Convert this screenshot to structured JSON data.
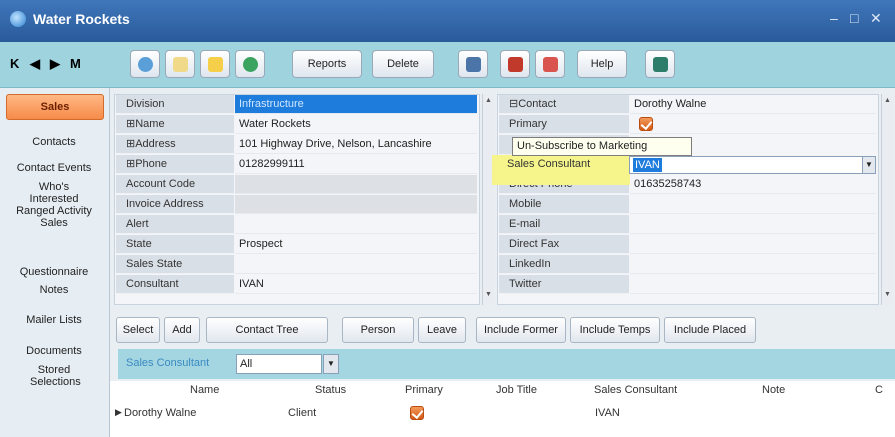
{
  "window": {
    "title": "Water Rockets"
  },
  "toolbar": {
    "nav": [
      "K",
      "◀",
      "▶",
      "M"
    ],
    "reports_label": "Reports",
    "delete_label": "Delete",
    "help_label": "Help"
  },
  "sidebar": {
    "items": [
      {
        "label": "Sales"
      },
      {
        "label": "Contacts"
      },
      {
        "label": "Contact Events"
      },
      {
        "label": "Who's Interested Ranged Activity Sales"
      },
      {
        "label": "Questionnaire"
      },
      {
        "label": "Notes"
      },
      {
        "label": "Mailer Lists"
      },
      {
        "label": "Documents"
      },
      {
        "label": "Stored Selections"
      }
    ]
  },
  "details": {
    "rows": [
      {
        "label": "Division",
        "value": "Infrastructure"
      },
      {
        "label": "⊞Name",
        "value": "Water Rockets"
      },
      {
        "label": "⊞Address",
        "value": "101 Highway Drive, Nelson, Lancashire"
      },
      {
        "label": "⊞Phone",
        "value": "01282999111"
      },
      {
        "label": "Account Code",
        "value": ""
      },
      {
        "label": "Invoice Address",
        "value": ""
      },
      {
        "label": "Alert",
        "value": ""
      },
      {
        "label": "State",
        "value": "Prospect"
      },
      {
        "label": "Sales State",
        "value": ""
      },
      {
        "label": "Consultant",
        "value": "IVAN"
      }
    ]
  },
  "contact": {
    "rows": [
      {
        "label": "⊟Contact",
        "value": "Dorothy Walne"
      },
      {
        "label": "Primary",
        "value": ""
      },
      {
        "label": "Un-Subscribe to Marketing",
        "value": ""
      },
      {
        "label": "Sales Consultant",
        "value": "IVAN"
      },
      {
        "label": "Direct Phone",
        "value": "01635258743"
      },
      {
        "label": "Mobile",
        "value": ""
      },
      {
        "label": "E-mail",
        "value": ""
      },
      {
        "label": "Direct Fax",
        "value": ""
      },
      {
        "label": "LinkedIn",
        "value": ""
      },
      {
        "label": "Twitter",
        "value": ""
      }
    ],
    "tooltip": "Un-Subscribe to Marketing"
  },
  "bottom": {
    "buttons": {
      "select": "Select",
      "add": "Add",
      "contact_tree": "Contact Tree",
      "person": "Person",
      "leave": "Leave",
      "include_former": "Include Former",
      "include_temps": "Include Temps",
      "include_placed": "Include Placed"
    },
    "filter": {
      "label": "Sales Consultant",
      "value": "All"
    },
    "columns": [
      "Name",
      "Status",
      "Primary",
      "Job Title",
      "Sales Consultant",
      "Note",
      "C"
    ],
    "rows": [
      {
        "name": "Dorothy Walne",
        "status": "Client",
        "primary": true,
        "job_title": "",
        "sales_consultant": "IVAN",
        "note": ""
      }
    ]
  },
  "colors": {
    "accent": "#1e7cdc",
    "toolbar": "#9fd4df",
    "active_tab": "#f68b4a",
    "highlight": "#f5f58c"
  }
}
